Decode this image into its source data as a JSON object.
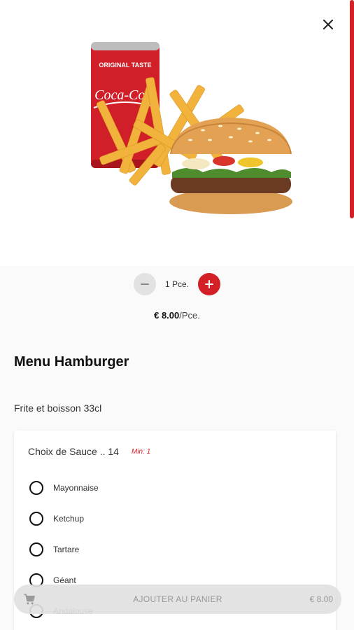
{
  "product": {
    "title": "Menu Hamburger",
    "description": "Frite et boisson 33cl",
    "can_text_top": "ORIGINAL TASTE",
    "can_text_brand": "Coca-Cola"
  },
  "quantity": {
    "label": "1 Pce."
  },
  "price": {
    "amount": "€ 8.00",
    "unit": "/Pce."
  },
  "options_group": {
    "title": "Choix de Sauce .. 14",
    "min_label": "Min: 1",
    "options": [
      "Mayonnaise",
      "Ketchup",
      "Tartare",
      "Géant",
      "Andalouse"
    ]
  },
  "cart": {
    "button_label": "AJOUTER AU PANIER",
    "total": "€ 8.00"
  },
  "icons": {
    "close": "close-icon",
    "minus": "minus-icon",
    "plus": "plus-icon",
    "cart": "cart-icon"
  },
  "colors": {
    "accent": "#d32027",
    "neutral_button": "#e2e2e2"
  }
}
